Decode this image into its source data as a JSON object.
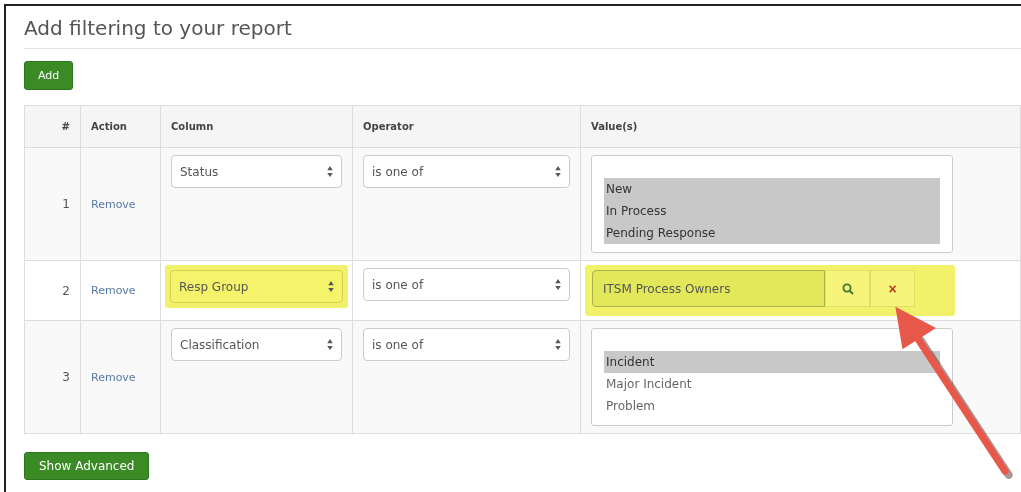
{
  "title": "Add filtering to your report",
  "add_button": "Add",
  "table": {
    "columns": [
      "#",
      "Action",
      "Column",
      "Operator",
      "Value(s)"
    ],
    "rows": [
      {
        "number": "1",
        "action": "Remove",
        "column": {
          "value": "Status",
          "highlighted": false
        },
        "operator": "is one of",
        "values": {
          "kind": "listbox",
          "highlighted": false,
          "options": [
            {
              "label": "New",
              "selected": true
            },
            {
              "label": "In Process",
              "selected": true
            },
            {
              "label": "Pending Response",
              "selected": true
            }
          ]
        }
      },
      {
        "number": "2",
        "action": "Remove",
        "column": {
          "value": "Resp Group",
          "highlighted": true
        },
        "operator": "is one of",
        "values": {
          "kind": "lookup",
          "highlighted": true,
          "value": "ITSM Process Owners",
          "clear_label": "×"
        }
      },
      {
        "number": "3",
        "action": "Remove",
        "column": {
          "value": "Classification",
          "highlighted": false
        },
        "operator": "is one of",
        "values": {
          "kind": "listbox",
          "highlighted": false,
          "options": [
            {
              "label": "Incident",
              "selected": true
            },
            {
              "label": "Major Incident",
              "selected": false
            },
            {
              "label": "Problem",
              "selected": false
            }
          ]
        }
      }
    ]
  },
  "show_advanced_button": "Show Advanced"
}
